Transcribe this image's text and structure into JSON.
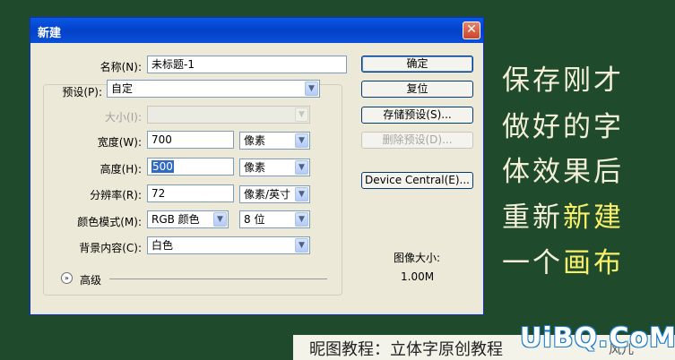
{
  "dialog": {
    "title": "新建",
    "close_glyph": "✕",
    "name_label": "名称(N):",
    "name_value": "未标题-1",
    "preset_label": "预设(P):",
    "preset_value": "自定",
    "size_label": "大小(I):",
    "size_value": "",
    "width_label": "宽度(W):",
    "width_value": "700",
    "width_unit": "像素",
    "height_label": "高度(H):",
    "height_value": "500",
    "height_unit": "像素",
    "resolution_label": "分辨率(R):",
    "resolution_value": "72",
    "resolution_unit": "像素/英寸",
    "color_mode_label": "颜色模式(M):",
    "color_mode_value": "RGB 颜色",
    "bit_depth_value": "8 位",
    "background_label": "背景内容(C):",
    "background_value": "白色",
    "advanced_label": "高级",
    "buttons": {
      "ok": "确定",
      "reset": "复位",
      "save_preset": "存储预设(S)...",
      "delete_preset": "删除预设(D)...",
      "device_central": "Device Central(E)..."
    },
    "image_size_label": "图像大小:",
    "image_size_value": "1.00M"
  },
  "side_text": {
    "line1": "保存刚才",
    "line2": "做好的字",
    "line3": "体效果后",
    "line4_white": "重新",
    "line4_yellow": "新建",
    "line5_white": "一个",
    "line5_yellow": "画布"
  },
  "caption": {
    "text": "昵图教程：立体字原创教程",
    "author": "风儿",
    "watermark": "UiBQ.CoM"
  },
  "icons": {
    "dropdown": "▼",
    "expand": "»"
  },
  "colors": {
    "background": "#1f4a2c",
    "dialog": "#ece9d8",
    "titlebar": "#0a58e6",
    "yellow_text": "#f8ef6a",
    "white_text": "#f4f0d8"
  }
}
